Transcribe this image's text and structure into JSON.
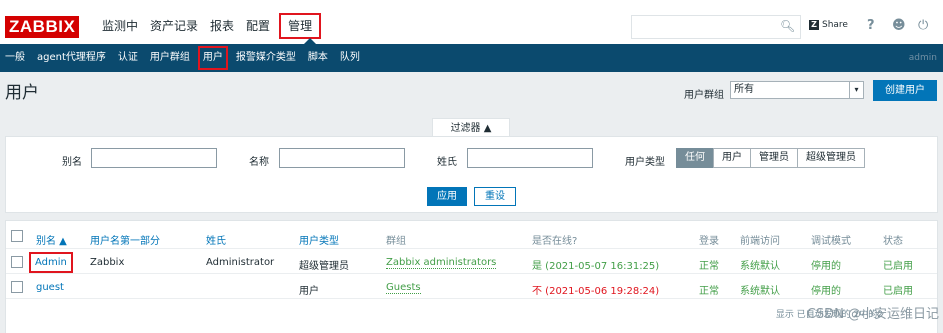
{
  "header": {
    "logo": "ZABBIX",
    "nav": [
      "监测中",
      "资产记录",
      "报表",
      "配置"
    ],
    "nav_selected": "管理",
    "share_label": "Share",
    "help_label": "?",
    "icons": [
      "search-icon",
      "share-icon",
      "help-icon",
      "user-icon",
      "power-icon"
    ]
  },
  "subnav": {
    "items": [
      "一般",
      "agent代理程序",
      "认证",
      "用户群组"
    ],
    "selected": "用户",
    "items_after": [
      "报警媒介类型",
      "脚本",
      "队列"
    ],
    "user": "admin"
  },
  "page": {
    "title": "用户",
    "group_label": "用户群组",
    "group_value": "所有",
    "create_button": "创建用户"
  },
  "filter": {
    "tab_label": "过滤器 ▲",
    "alias_label": "别名",
    "name_label": "名称",
    "surname_label": "姓氏",
    "user_type_label": "用户类型",
    "user_types": [
      "任何",
      "用户",
      "管理员",
      "超级管理员"
    ],
    "user_type_selected": "任何",
    "apply_button": "应用",
    "reset_button": "重设"
  },
  "table": {
    "columns": [
      "别名 ▲",
      "用户名第一部分",
      "姓氏",
      "用户类型",
      "群组",
      "是否在线?",
      "登录",
      "前端访问",
      "调试模式",
      "状态"
    ],
    "rows": [
      {
        "alias": "Admin",
        "name": "Zabbix",
        "surname": "Administrator",
        "type": "超级管理员",
        "groups": "Zabbix administrators",
        "online": "是 (2021-05-07 16:31:25)",
        "login": "正常",
        "frontend": "系统默认",
        "debug": "停用的",
        "status": "已启用"
      },
      {
        "alias": "guest",
        "name": "",
        "surname": "",
        "type": "用户",
        "groups": "Guests",
        "online": "不 (2021-05-06 19:28:24)",
        "login": "正常",
        "frontend": "系统默认",
        "debug": "停用的",
        "status": "已启用"
      }
    ],
    "footer": "显示 已自动发现的 2中的2"
  },
  "watermark": "CSDN @小安运维日记",
  "colors": {
    "brand": "#d40000",
    "nav_bg": "#0b4a6e",
    "accent": "#0275b8",
    "ok": "#429e47",
    "bad": "#e0151e",
    "highlight": "#e0151e"
  }
}
